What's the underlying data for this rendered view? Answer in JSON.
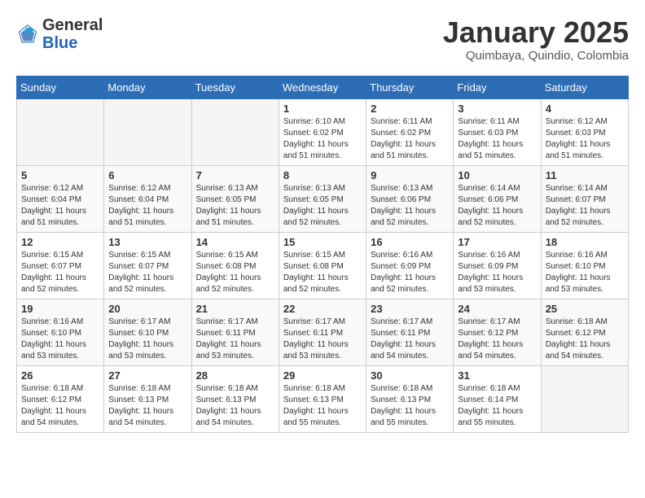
{
  "header": {
    "logo_general": "General",
    "logo_blue": "Blue",
    "month": "January 2025",
    "location": "Quimbaya, Quindio, Colombia"
  },
  "weekdays": [
    "Sunday",
    "Monday",
    "Tuesday",
    "Wednesday",
    "Thursday",
    "Friday",
    "Saturday"
  ],
  "weeks": [
    [
      {
        "day": "",
        "empty": true
      },
      {
        "day": "",
        "empty": true
      },
      {
        "day": "",
        "empty": true
      },
      {
        "day": "1",
        "sunrise": "6:10 AM",
        "sunset": "6:02 PM",
        "daylight": "11 hours and 51 minutes."
      },
      {
        "day": "2",
        "sunrise": "6:11 AM",
        "sunset": "6:02 PM",
        "daylight": "11 hours and 51 minutes."
      },
      {
        "day": "3",
        "sunrise": "6:11 AM",
        "sunset": "6:03 PM",
        "daylight": "11 hours and 51 minutes."
      },
      {
        "day": "4",
        "sunrise": "6:12 AM",
        "sunset": "6:03 PM",
        "daylight": "11 hours and 51 minutes."
      }
    ],
    [
      {
        "day": "5",
        "sunrise": "6:12 AM",
        "sunset": "6:04 PM",
        "daylight": "11 hours and 51 minutes."
      },
      {
        "day": "6",
        "sunrise": "6:12 AM",
        "sunset": "6:04 PM",
        "daylight": "11 hours and 51 minutes."
      },
      {
        "day": "7",
        "sunrise": "6:13 AM",
        "sunset": "6:05 PM",
        "daylight": "11 hours and 51 minutes."
      },
      {
        "day": "8",
        "sunrise": "6:13 AM",
        "sunset": "6:05 PM",
        "daylight": "11 hours and 52 minutes."
      },
      {
        "day": "9",
        "sunrise": "6:13 AM",
        "sunset": "6:06 PM",
        "daylight": "11 hours and 52 minutes."
      },
      {
        "day": "10",
        "sunrise": "6:14 AM",
        "sunset": "6:06 PM",
        "daylight": "11 hours and 52 minutes."
      },
      {
        "day": "11",
        "sunrise": "6:14 AM",
        "sunset": "6:07 PM",
        "daylight": "11 hours and 52 minutes."
      }
    ],
    [
      {
        "day": "12",
        "sunrise": "6:15 AM",
        "sunset": "6:07 PM",
        "daylight": "11 hours and 52 minutes."
      },
      {
        "day": "13",
        "sunrise": "6:15 AM",
        "sunset": "6:07 PM",
        "daylight": "11 hours and 52 minutes."
      },
      {
        "day": "14",
        "sunrise": "6:15 AM",
        "sunset": "6:08 PM",
        "daylight": "11 hours and 52 minutes."
      },
      {
        "day": "15",
        "sunrise": "6:15 AM",
        "sunset": "6:08 PM",
        "daylight": "11 hours and 52 minutes."
      },
      {
        "day": "16",
        "sunrise": "6:16 AM",
        "sunset": "6:09 PM",
        "daylight": "11 hours and 52 minutes."
      },
      {
        "day": "17",
        "sunrise": "6:16 AM",
        "sunset": "6:09 PM",
        "daylight": "11 hours and 53 minutes."
      },
      {
        "day": "18",
        "sunrise": "6:16 AM",
        "sunset": "6:10 PM",
        "daylight": "11 hours and 53 minutes."
      }
    ],
    [
      {
        "day": "19",
        "sunrise": "6:16 AM",
        "sunset": "6:10 PM",
        "daylight": "11 hours and 53 minutes."
      },
      {
        "day": "20",
        "sunrise": "6:17 AM",
        "sunset": "6:10 PM",
        "daylight": "11 hours and 53 minutes."
      },
      {
        "day": "21",
        "sunrise": "6:17 AM",
        "sunset": "6:11 PM",
        "daylight": "11 hours and 53 minutes."
      },
      {
        "day": "22",
        "sunrise": "6:17 AM",
        "sunset": "6:11 PM",
        "daylight": "11 hours and 53 minutes."
      },
      {
        "day": "23",
        "sunrise": "6:17 AM",
        "sunset": "6:11 PM",
        "daylight": "11 hours and 54 minutes."
      },
      {
        "day": "24",
        "sunrise": "6:17 AM",
        "sunset": "6:12 PM",
        "daylight": "11 hours and 54 minutes."
      },
      {
        "day": "25",
        "sunrise": "6:18 AM",
        "sunset": "6:12 PM",
        "daylight": "11 hours and 54 minutes."
      }
    ],
    [
      {
        "day": "26",
        "sunrise": "6:18 AM",
        "sunset": "6:12 PM",
        "daylight": "11 hours and 54 minutes."
      },
      {
        "day": "27",
        "sunrise": "6:18 AM",
        "sunset": "6:13 PM",
        "daylight": "11 hours and 54 minutes."
      },
      {
        "day": "28",
        "sunrise": "6:18 AM",
        "sunset": "6:13 PM",
        "daylight": "11 hours and 54 minutes."
      },
      {
        "day": "29",
        "sunrise": "6:18 AM",
        "sunset": "6:13 PM",
        "daylight": "11 hours and 55 minutes."
      },
      {
        "day": "30",
        "sunrise": "6:18 AM",
        "sunset": "6:13 PM",
        "daylight": "11 hours and 55 minutes."
      },
      {
        "day": "31",
        "sunrise": "6:18 AM",
        "sunset": "6:14 PM",
        "daylight": "11 hours and 55 minutes."
      },
      {
        "day": "",
        "empty": true
      }
    ]
  ],
  "labels": {
    "sunrise": "Sunrise:",
    "sunset": "Sunset:",
    "daylight": "Daylight:"
  }
}
